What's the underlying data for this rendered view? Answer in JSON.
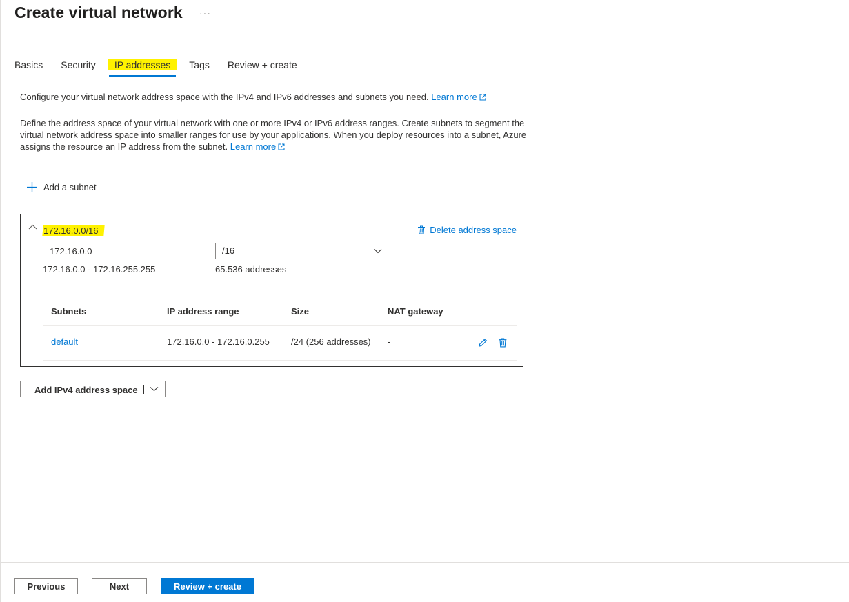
{
  "page": {
    "title": "Create virtual network",
    "more_icon": "ellipsis-icon",
    "more_label": "···"
  },
  "tabs": [
    {
      "label": "Basics"
    },
    {
      "label": "Security"
    },
    {
      "label": "IP addresses",
      "active": true
    },
    {
      "label": "Tags"
    },
    {
      "label": "Review + create"
    }
  ],
  "intro": {
    "line1": "Configure your virtual network address space with the IPv4 and IPv6 addresses and subnets you need.",
    "line1_link": "Learn more",
    "line2": "Define the address space of your virtual network with one or more IPv4 or IPv6 address ranges. Create subnets to segment the virtual network address space into smaller ranges for use by your applications. When you deploy resources into a subnet, Azure assigns the resource an IP address from the subnet.",
    "line2_link": "Learn more"
  },
  "add_subnet_label": "Add a subnet",
  "address_space": {
    "cidr": "172.16.0.0/16",
    "delete_label": "Delete address space",
    "ip_value": "172.16.0.0",
    "prefix_value": "/16",
    "range": "172.16.0.0 - 172.16.255.255",
    "count": "65.536 addresses",
    "table": {
      "headers": [
        "Subnets",
        "IP address range",
        "Size",
        "NAT gateway"
      ],
      "rows": [
        {
          "name": "default",
          "range": "172.16.0.0 - 172.16.0.255",
          "size": "/24 (256 addresses)",
          "nat": "-"
        }
      ]
    }
  },
  "add_space_label": "Add IPv4 address space",
  "footer": {
    "previous": "Previous",
    "next": "Next",
    "review": "Review + create"
  },
  "colors": {
    "accent": "#0078d4",
    "highlight": "#fff200"
  }
}
